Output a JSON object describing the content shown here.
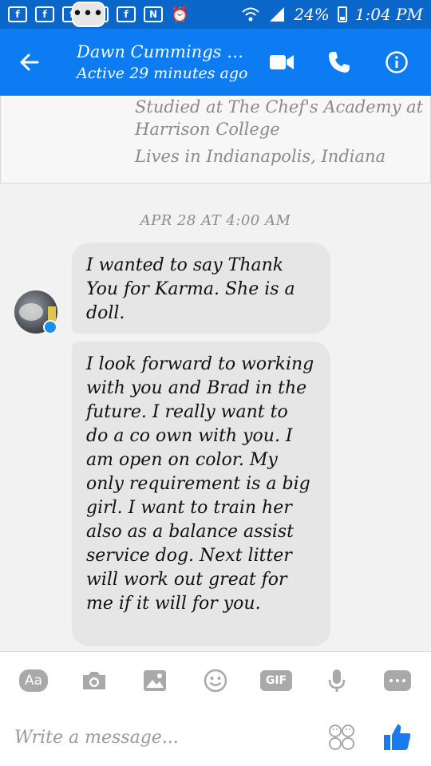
{
  "status_bar": {
    "battery": "24%",
    "time": "1:04 PM",
    "notification_icons": [
      "chat-bubble-icon",
      "facebook-icon",
      "facebook-icon",
      "facebook-icon",
      "facebook-icon",
      "facebook-icon",
      "nfc-icon",
      "alarm-icon",
      "wifi-icon",
      "signal-icon",
      "battery-icon"
    ]
  },
  "header": {
    "name": "Dawn Cummings F...",
    "status": "Active 29 minutes ago",
    "actions": [
      "video-call-icon",
      "phone-icon",
      "info-icon"
    ]
  },
  "profile": {
    "education": "Studied at The Chef's Academy at Harrison College",
    "location": "Lives in Indianapolis, Indiana"
  },
  "conversation": {
    "date": "APR 28 AT 4:00 AM",
    "messages": [
      "I wanted to say Thank You for Karma. She is a doll.",
      "I look forward to working with you and Brad in the future. I really want to do a co own with you. I am open on color. My only requirement is a big girl. I want to train her also as a balance assist service dog. Next litter will work out great for me if it will for you."
    ]
  },
  "composer": {
    "text_button": "Aa",
    "gif_button": "GIF",
    "placeholder": "Write a message..."
  },
  "colors": {
    "status_bar": "#0a66c8",
    "header": "#0d7cf2",
    "bubble": "#e6e6e6",
    "like": "#1a7bf0"
  }
}
